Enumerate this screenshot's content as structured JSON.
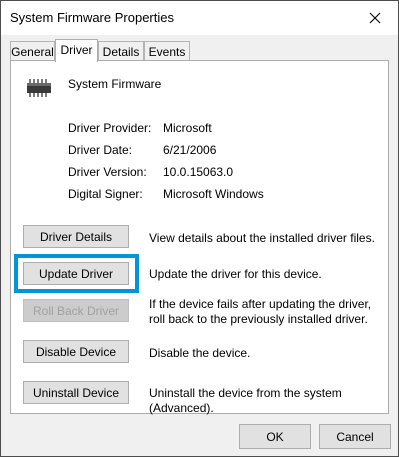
{
  "window": {
    "title": "System Firmware Properties"
  },
  "tabs": [
    {
      "label": "General"
    },
    {
      "label": "Driver"
    },
    {
      "label": "Details"
    },
    {
      "label": "Events"
    }
  ],
  "device": {
    "name": "System Firmware",
    "icon": "chip-icon"
  },
  "info": [
    {
      "label": "Driver Provider:",
      "value": "Microsoft"
    },
    {
      "label": "Driver Date:",
      "value": "6/21/2006"
    },
    {
      "label": "Driver Version:",
      "value": "10.0.15063.0"
    },
    {
      "label": "Digital Signer:",
      "value": "Microsoft Windows"
    }
  ],
  "actions": [
    {
      "label": "Driver Details",
      "desc": "View details about the installed driver files.",
      "enabled": true
    },
    {
      "label": "Update Driver",
      "desc": "Update the driver for this device.",
      "enabled": true,
      "highlighted": true
    },
    {
      "label": "Roll Back Driver",
      "desc": "If the device fails after updating the driver, roll back to the previously installed driver.",
      "enabled": false
    },
    {
      "label": "Disable Device",
      "desc": "Disable the device.",
      "enabled": true
    },
    {
      "label": "Uninstall Device",
      "desc": "Uninstall the device from the system (Advanced).",
      "enabled": true
    }
  ],
  "footer": {
    "ok_label": "OK",
    "cancel_label": "Cancel"
  },
  "colors": {
    "highlight_border": "#0096d6"
  }
}
